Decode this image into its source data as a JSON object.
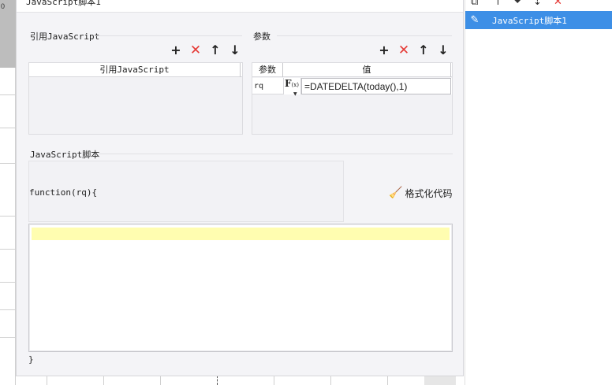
{
  "background": {
    "row_number": "0"
  },
  "right_panel": {
    "toolbar_icons": [
      "copy-icon",
      "arrow-up-icon",
      "arrow-down-icon",
      "move-down-icon",
      "delete-icon"
    ],
    "items": [
      {
        "label": "JavaScript脚本1",
        "icon": "pencil-icon",
        "selected": true
      }
    ],
    "selected_color": "#3d8fe6"
  },
  "dialog": {
    "title": "JavaScript脚本1",
    "ref_js": {
      "label": "引用JavaScript",
      "column_header": "引用JavaScript"
    },
    "params": {
      "label": "参数",
      "columns": {
        "name": "参数",
        "value": "值"
      },
      "rows": [
        {
          "name": "rq",
          "fx_main": "F",
          "fx_sub": "(x)",
          "value": "=DATEDELTA(today(),1)"
        }
      ]
    },
    "script": {
      "label": "JavaScript脚本",
      "function_header": "function(rq){",
      "format_label": "格式化代码",
      "closing": "}",
      "code": ""
    },
    "icons": {
      "add": "+",
      "delete": "✕",
      "up": "🡑",
      "down": "🡓"
    },
    "colors": {
      "delete_red": "#e53935",
      "current_line": "#fffdb0"
    }
  }
}
